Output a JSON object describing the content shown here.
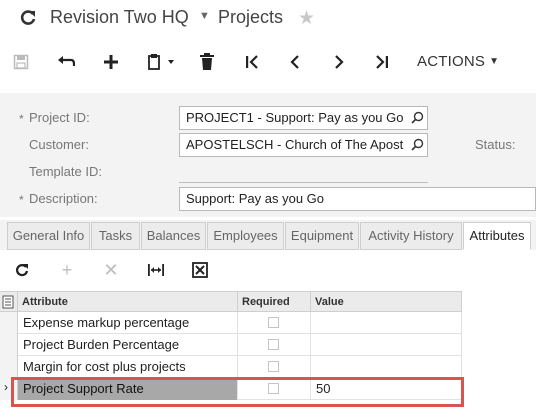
{
  "header": {
    "company": "Revision Two HQ",
    "separator": "Projects"
  },
  "toolbar": {
    "actions_label": "ACTIONS"
  },
  "form": {
    "project_id_label": "Project ID:",
    "project_id_value": "PROJECT1 - Support: Pay as you Go",
    "customer_label": "Customer:",
    "customer_value": "APOSTELSCH - Church of The Apost",
    "status_label": "Status:",
    "template_id_label": "Template ID:",
    "description_label": "Description:",
    "description_value": "Support: Pay as you Go"
  },
  "tabs": [
    {
      "label": "General Info"
    },
    {
      "label": "Tasks"
    },
    {
      "label": "Balances"
    },
    {
      "label": "Employees"
    },
    {
      "label": "Equipment"
    },
    {
      "label": "Activity History"
    },
    {
      "label": "Attributes"
    }
  ],
  "grid": {
    "headers": {
      "attribute": "Attribute",
      "required": "Required",
      "value": "Value"
    },
    "rows": [
      {
        "attribute": "Expense markup percentage",
        "required": false,
        "value": ""
      },
      {
        "attribute": "Project Burden Percentage",
        "required": false,
        "value": ""
      },
      {
        "attribute": "Margin for cost plus projects",
        "required": false,
        "value": ""
      },
      {
        "attribute": "Project Support Rate",
        "required": false,
        "value": "50"
      }
    ]
  },
  "colors": {
    "highlight": "#d9534f",
    "active_tab": "#ffffff"
  }
}
